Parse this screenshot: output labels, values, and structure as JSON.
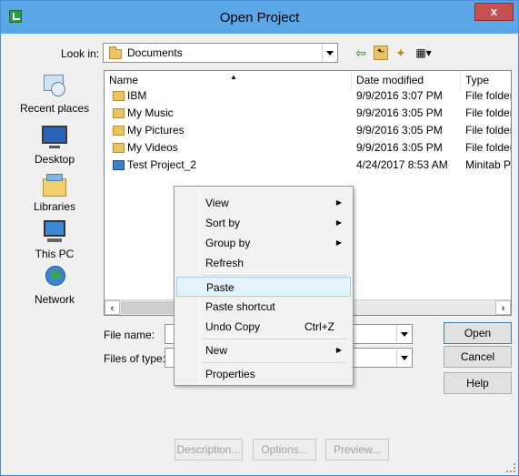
{
  "window": {
    "title": "Open Project",
    "close_label": "x"
  },
  "lookin": {
    "label": "Look in:",
    "value": "Documents"
  },
  "places": [
    {
      "label": "Recent places",
      "icon": "recent-places-icon"
    },
    {
      "label": "Desktop",
      "icon": "desktop-icon"
    },
    {
      "label": "Libraries",
      "icon": "libraries-icon"
    },
    {
      "label": "This PC",
      "icon": "this-pc-icon"
    },
    {
      "label": "Network",
      "icon": "network-icon"
    }
  ],
  "columns": [
    "Name",
    "Date modified",
    "Type"
  ],
  "files": [
    {
      "name": "IBM",
      "date": "9/9/2016 3:07 PM",
      "type": "File folder",
      "icon": "folder-icon"
    },
    {
      "name": "My Music",
      "date": "9/9/2016 3:05 PM",
      "type": "File folder",
      "icon": "music-folder-icon"
    },
    {
      "name": "My Pictures",
      "date": "9/9/2016 3:05 PM",
      "type": "File folder",
      "icon": "pictures-folder-icon"
    },
    {
      "name": "My Videos",
      "date": "9/9/2016 3:05 PM",
      "type": "File folder",
      "icon": "videos-folder-icon"
    },
    {
      "name": "Test Project_2",
      "date": "4/24/2017 8:53 AM",
      "type": "Minitab P",
      "icon": "minitab-project-icon"
    }
  ],
  "fields": {
    "filename_label": "File name:",
    "filetype_label": "Files of type:"
  },
  "buttons": {
    "open": "Open",
    "cancel": "Cancel",
    "help": "Help",
    "description": "Description...",
    "options": "Options...",
    "preview": "Preview..."
  },
  "context_menu": {
    "view": "View",
    "sort_by": "Sort by",
    "group_by": "Group by",
    "refresh": "Refresh",
    "paste": "Paste",
    "paste_shortcut": "Paste shortcut",
    "undo_copy": "Undo Copy",
    "undo_copy_shortcut": "Ctrl+Z",
    "new": "New",
    "properties": "Properties"
  },
  "colors": {
    "titlebar": "#5aa6e7",
    "close": "#c75050",
    "hover": "#e5f1fb"
  }
}
